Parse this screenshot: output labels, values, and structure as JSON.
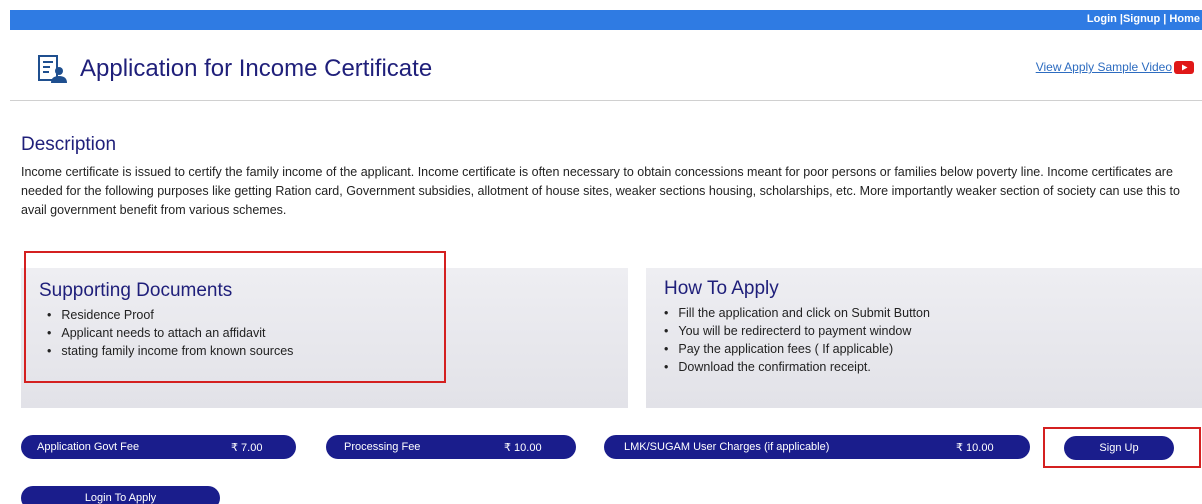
{
  "topbar": {
    "links": "Login |Signup | Home",
    "color": "#2f7be3"
  },
  "header": {
    "title": "Application for Income Certificate",
    "icon": "document-user-icon",
    "video_link": "View Apply Sample Video",
    "video_icon": "youtube-play-icon"
  },
  "description": {
    "heading": "Description",
    "text": "Income certificate is issued to certify the family income of the applicant. Income certificate is often necessary to obtain concessions meant for poor persons or families below poverty line. Income certificates are needed for the following purposes like getting Ration card, Government subsidies, allotment of house sites, weaker sections housing, scholarships, etc. More importantly weaker section of society can use this to avail government benefit from various schemes."
  },
  "supporting_documents": {
    "heading": "Supporting Documents",
    "items": [
      "Residence Proof",
      "Applicant needs to attach an affidavit",
      "stating family income from known sources"
    ]
  },
  "how_to_apply": {
    "heading": "How To Apply",
    "items": [
      "Fill the application and click on Submit Button",
      "You will be redirecterd to payment window",
      "Pay the application fees ( If applicable)",
      "Download the confirmation receipt."
    ]
  },
  "fees": {
    "govt_fee_label": "Application Govt Fee",
    "govt_fee_amount": "₹ 7.00",
    "processing_fee_label": "Processing Fee",
    "processing_fee_amount": "₹ 10.00",
    "user_charges_label": "LMK/SUGAM User Charges (if applicable)",
    "user_charges_amount": "₹ 10.00"
  },
  "actions": {
    "sign_up": "Sign Up",
    "login_to_apply": "Login To Apply"
  },
  "colors": {
    "accent": "#1a1d8c",
    "heading": "#1f1f7a",
    "highlight": "#d42020"
  }
}
